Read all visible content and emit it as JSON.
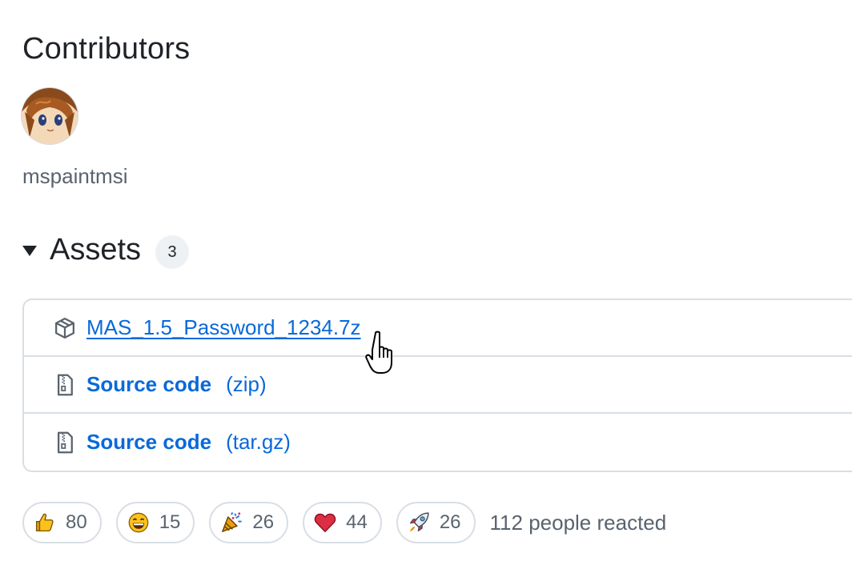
{
  "contributors": {
    "title": "Contributors",
    "users": [
      {
        "name": "mspaintmsi"
      }
    ]
  },
  "assets": {
    "title": "Assets",
    "count": "3",
    "items": [
      {
        "icon": "package-icon",
        "label": "MAS_1.5_Password_1234.7z",
        "suffix": ""
      },
      {
        "icon": "file-zip-icon",
        "label": "Source code",
        "suffix": "(zip)"
      },
      {
        "icon": "file-zip-icon",
        "label": "Source code",
        "suffix": "(tar.gz)"
      }
    ]
  },
  "reactions": {
    "items": [
      {
        "emoji": "thumbs-up",
        "count": "80"
      },
      {
        "emoji": "laugh",
        "count": "15"
      },
      {
        "emoji": "tada",
        "count": "26"
      },
      {
        "emoji": "heart",
        "count": "44"
      },
      {
        "emoji": "rocket",
        "count": "26"
      }
    ],
    "summary": "112 people reacted"
  },
  "colors": {
    "link": "#0969da",
    "muted": "#59636e",
    "border": "#d8dee4"
  }
}
